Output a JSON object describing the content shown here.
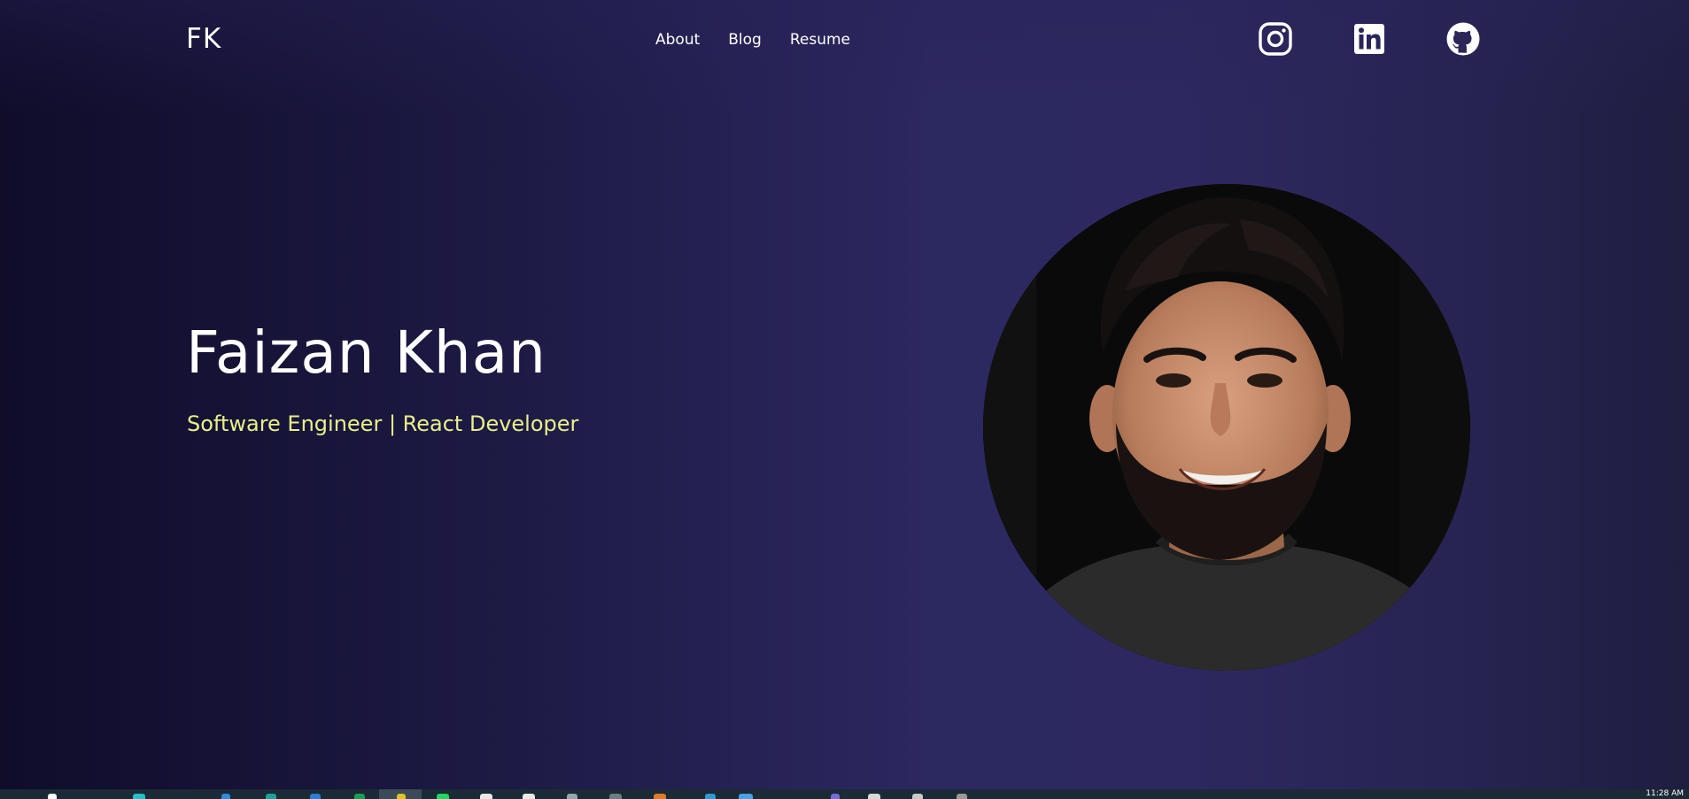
{
  "logo": "FK",
  "nav": {
    "about": "About",
    "blog": "Blog",
    "resume": "Resume"
  },
  "socials": [
    {
      "icon": "instagram-icon"
    },
    {
      "icon": "linkedin-icon"
    },
    {
      "icon": "github-icon"
    }
  ],
  "hero": {
    "name": "Faizan Khan",
    "subtitle": "Software Engineer | React Developer"
  },
  "taskbar": {
    "clock": "11:28 AM"
  },
  "colors": {
    "background_dark": "#100c2a",
    "background_mid": "#2c2860",
    "subtitle_accent": "#e9f08a",
    "text": "#ffffff"
  }
}
